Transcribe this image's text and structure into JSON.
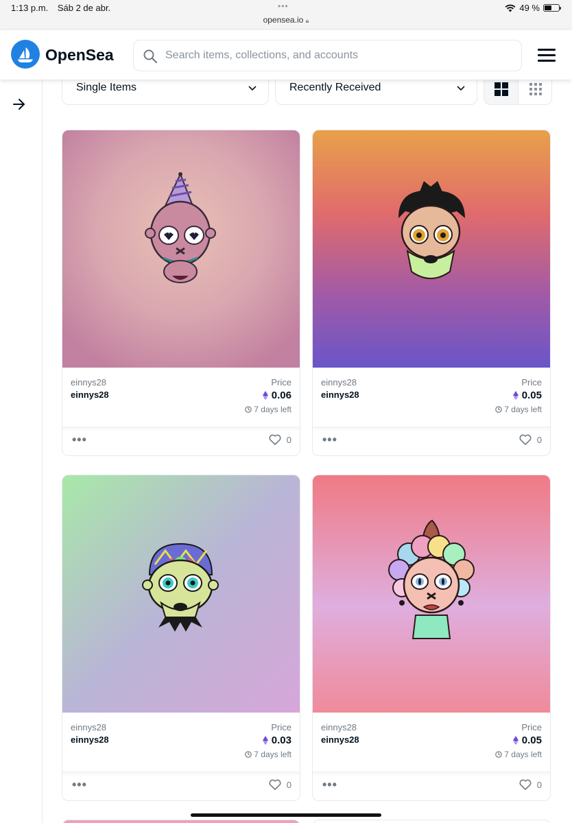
{
  "status_bar": {
    "time": "1:13 p.m.",
    "date": "Sáb 2 de abr.",
    "url": "opensea.io",
    "battery": "49 %"
  },
  "header": {
    "brand": "OpenSea",
    "search_placeholder": "Search items, collections, and accounts"
  },
  "filters": {
    "item_type": "Single Items",
    "sort": "Recently Received"
  },
  "cards": [
    {
      "creator": "einnys28",
      "name": "einnys28",
      "price_label": "Price",
      "price": "0.06",
      "time_left": "7 days left",
      "likes": "0"
    },
    {
      "creator": "einnys28",
      "name": "einnys28",
      "price_label": "Price",
      "price": "0.05",
      "time_left": "7 days left",
      "likes": "0"
    },
    {
      "creator": "einnys28",
      "name": "einnys28",
      "price_label": "Price",
      "price": "0.03",
      "time_left": "7 days left",
      "likes": "0"
    },
    {
      "creator": "einnys28",
      "name": "einnys28",
      "price_label": "Price",
      "price": "0.05",
      "time_left": "7 days left",
      "likes": "0"
    }
  ],
  "icons": {
    "logo": "opensea-logo-icon",
    "search": "search-icon",
    "menu": "hamburger-menu-icon",
    "rail": "arrow-right-icon",
    "eth": "ethereum-icon",
    "clock": "clock-icon",
    "like": "heart-icon",
    "more": "more-dots-icon"
  },
  "colors": {
    "brand_blue": "#2081e2",
    "text": "#04111d",
    "muted": "#707a83",
    "border": "#e5e8eb",
    "eth_purple": "#6f4bd8"
  }
}
